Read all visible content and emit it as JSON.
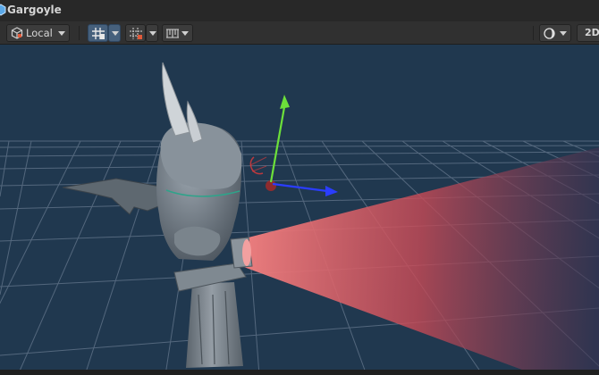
{
  "window": {
    "title": "Gargoyle",
    "title_icon": "unity-cube-icon"
  },
  "toolbar": {
    "pivot_rotation_label": "Local",
    "pivot_rotation_icon": "local-cube-icon",
    "grid_snap_icon": "grid-snap-icon",
    "increment_snap_icon": "increment-snap-icon",
    "ruler_icon": "ruler-icon",
    "shading_icon": "shading-sphere-icon",
    "mode_2d_label": "2D"
  },
  "scene": {
    "object_name": "Gargoyle",
    "colors": {
      "sky": "#20384f",
      "grid_line": "#7e8ea3",
      "gizmo_x": "#2a3dff",
      "gizmo_y": "#6ce03a",
      "gizmo_z": "#e23a3a",
      "light_cone": "#e26262",
      "active_toggle": "#46607c"
    }
  }
}
